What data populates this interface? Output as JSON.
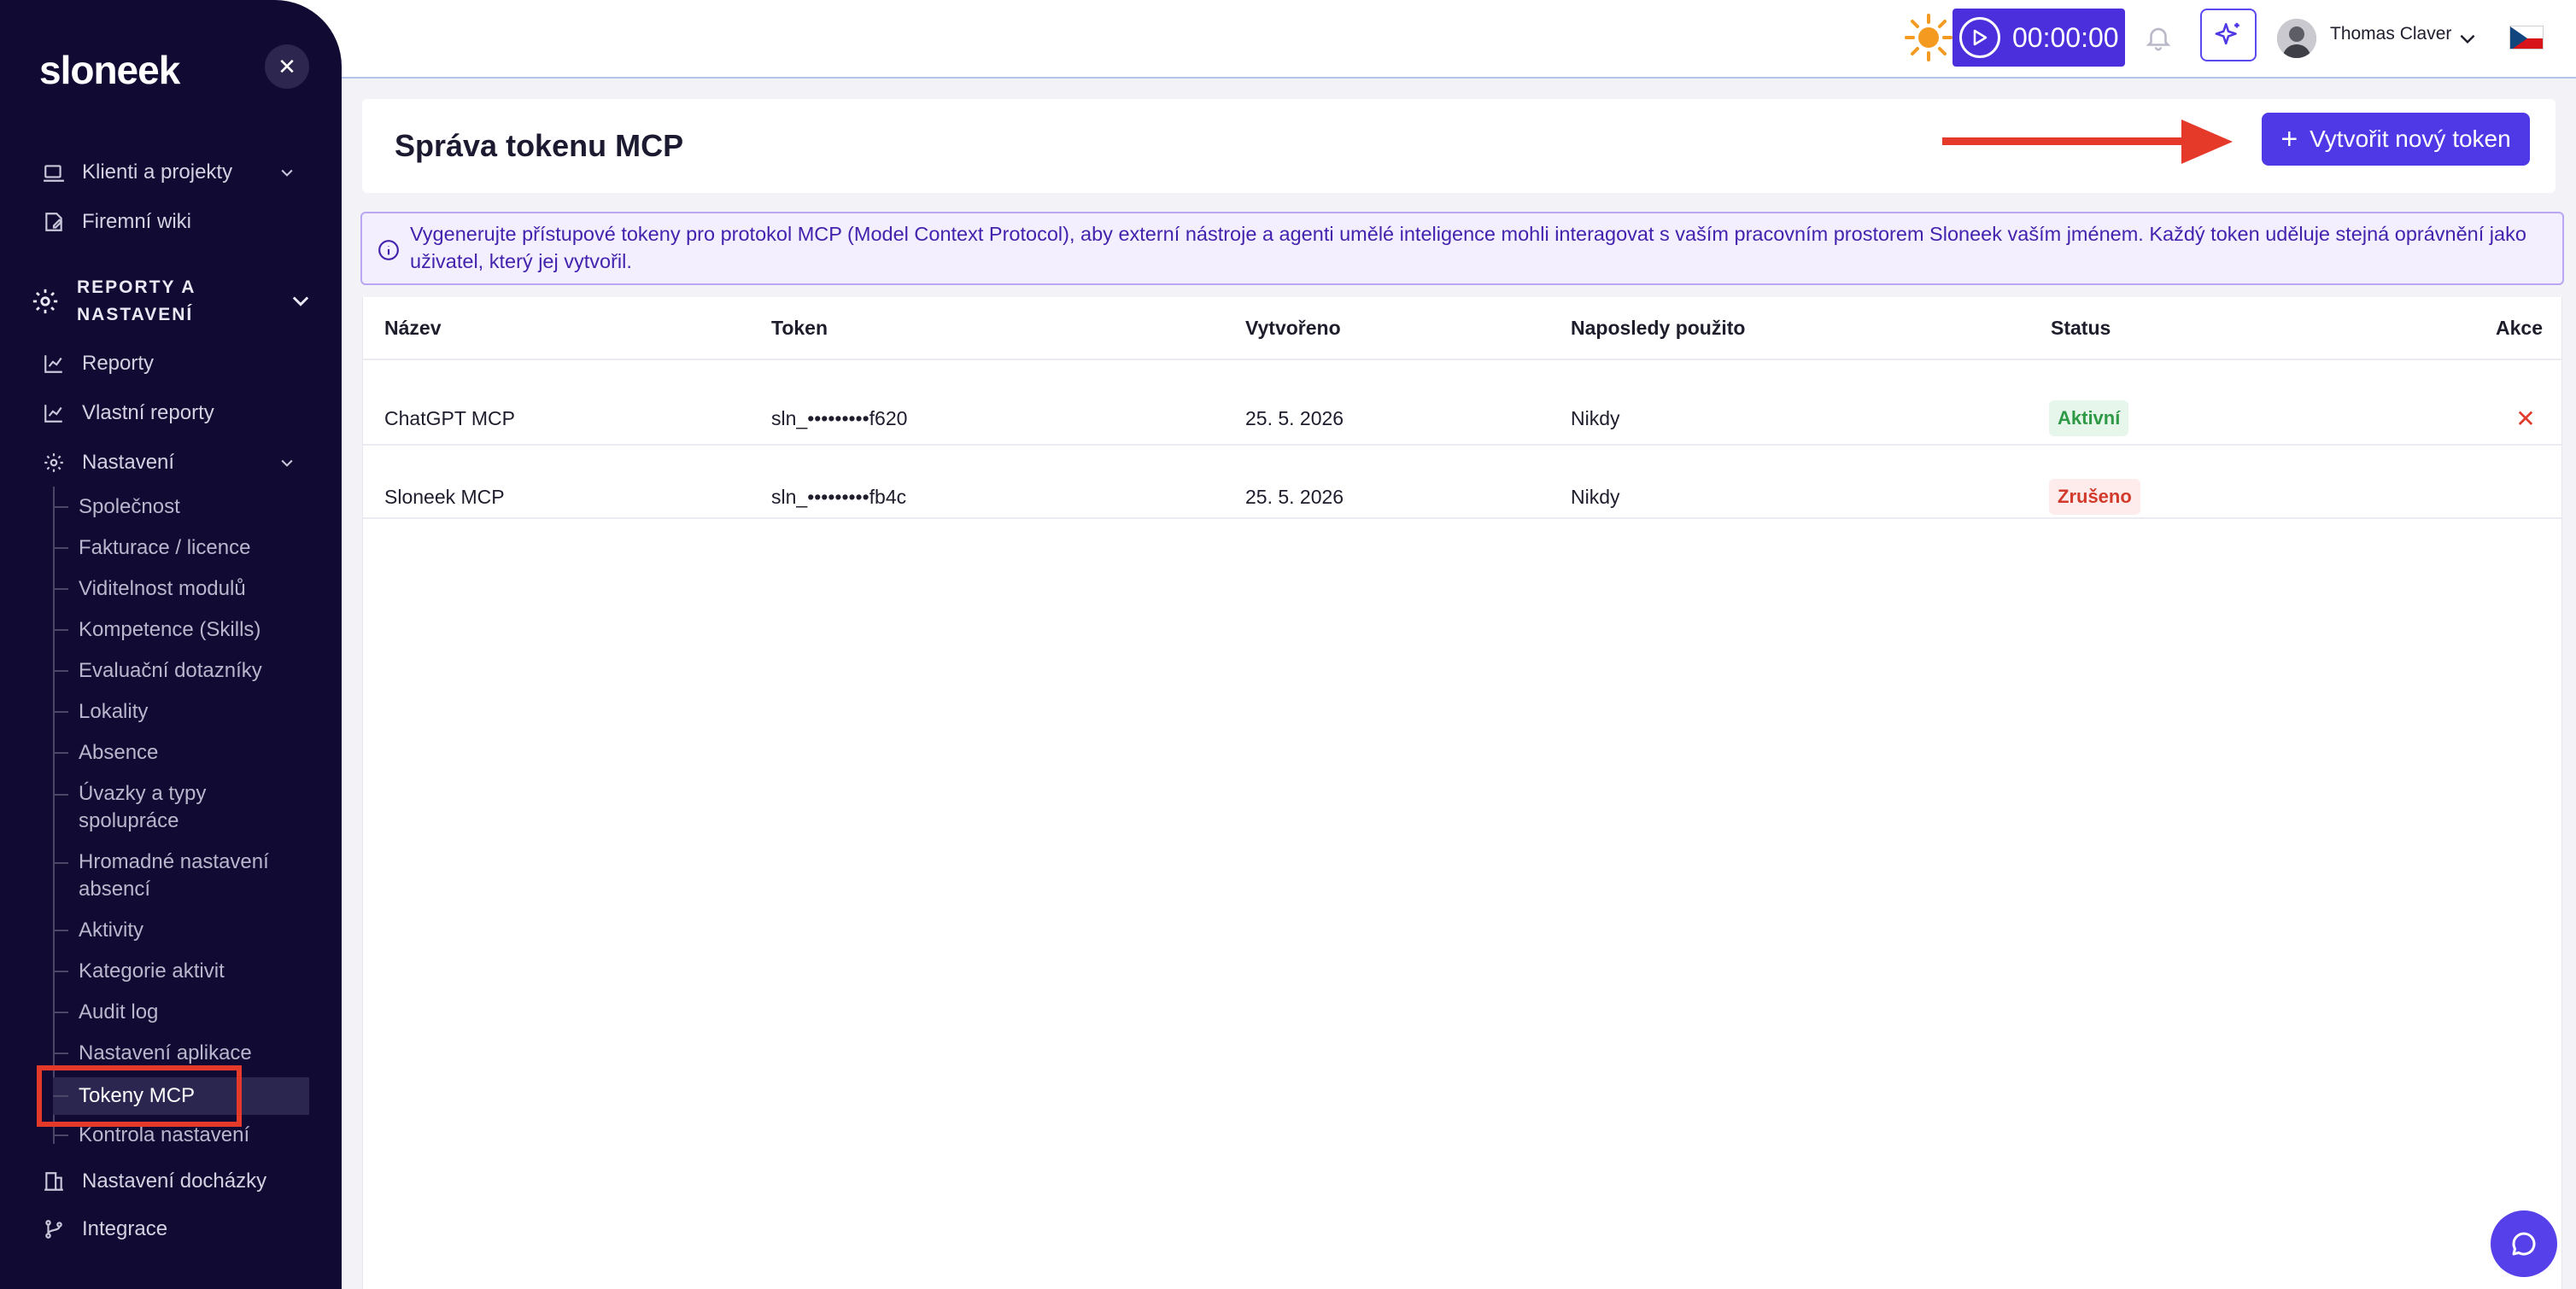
{
  "app": {
    "logo_text": "sloneek",
    "accent_color": "#4f39e7",
    "sidebar_bg": "#110a33"
  },
  "sidebar": {
    "close_icon": "close-icon",
    "items": [
      {
        "label": "Klienti a projekty",
        "icon": "briefcase-icon",
        "expandable": true
      },
      {
        "label": "Firemní wiki",
        "icon": "book-edit-icon",
        "expandable": false
      }
    ],
    "section": {
      "label": "REPORTY A NASTAVENÍ",
      "icon": "gear-icon"
    },
    "section_items": [
      {
        "label": "Reporty",
        "icon": "chart-line-icon"
      },
      {
        "label": "Vlastní reporty",
        "icon": "chart-line-icon"
      },
      {
        "label": "Nastavení",
        "icon": "gear-icon",
        "expandable": true
      }
    ],
    "settings_sub_items": [
      "Společnost",
      "Fakturace / licence",
      "Viditelnost modulů",
      "Kompetence (Skills)",
      "Evaluační dotazníky",
      "Lokality",
      "Absence",
      "Úvazky a typy spolupráce",
      "Hromadné nastavení absencí",
      "Aktivity",
      "Kategorie aktivit",
      "Audit log",
      "Nastavení aplikace",
      "Tokeny MCP",
      "Kontrola nastavení"
    ],
    "active_sub_item": "Tokeny MCP",
    "bottom_items": [
      {
        "label": "Nastavení docházky",
        "icon": "building-icon"
      },
      {
        "label": "Integrace",
        "icon": "git-branch-icon"
      }
    ]
  },
  "topbar": {
    "theme_icon": "sun-icon",
    "timer": "00:00:00",
    "timer_icon": "play-icon",
    "notifications_icon": "bell-icon",
    "ai_icon": "sparkles-icon",
    "user_name": "Thomas Claver",
    "language_icon": "czech-flag-icon"
  },
  "page": {
    "title": "Správa tokenu MCP",
    "create_button": "Vytvořit nový token",
    "info_text": "Vygenerujte přístupové tokeny pro protokol MCP (Model Context Protocol), aby externí nástroje a agenti umělé inteligence mohli interagovat s vaším pracovním prostorem Sloneek vaším jménem. Každý token uděluje stejná oprávnění jako uživatel, který jej vytvořil."
  },
  "table": {
    "columns": [
      "Název",
      "Token",
      "Vytvořeno",
      "Naposledy použito",
      "Status",
      "Akce"
    ],
    "rows": [
      {
        "name": "ChatGPT MCP",
        "token": "sln_•••••••••f620",
        "created": "25. 5. 2026",
        "last_used": "Nikdy",
        "status": "Aktivní",
        "status_color": "#2f9a46",
        "action_icon": "close-icon"
      },
      {
        "name": "Sloneek MCP",
        "token": "sln_•••••••••fb4c",
        "created": "25. 5. 2026",
        "last_used": "Nikdy",
        "status": "Zrušeno",
        "status_color": "#d23a2b"
      }
    ]
  },
  "chat_icon": "chat-bubble-icon"
}
